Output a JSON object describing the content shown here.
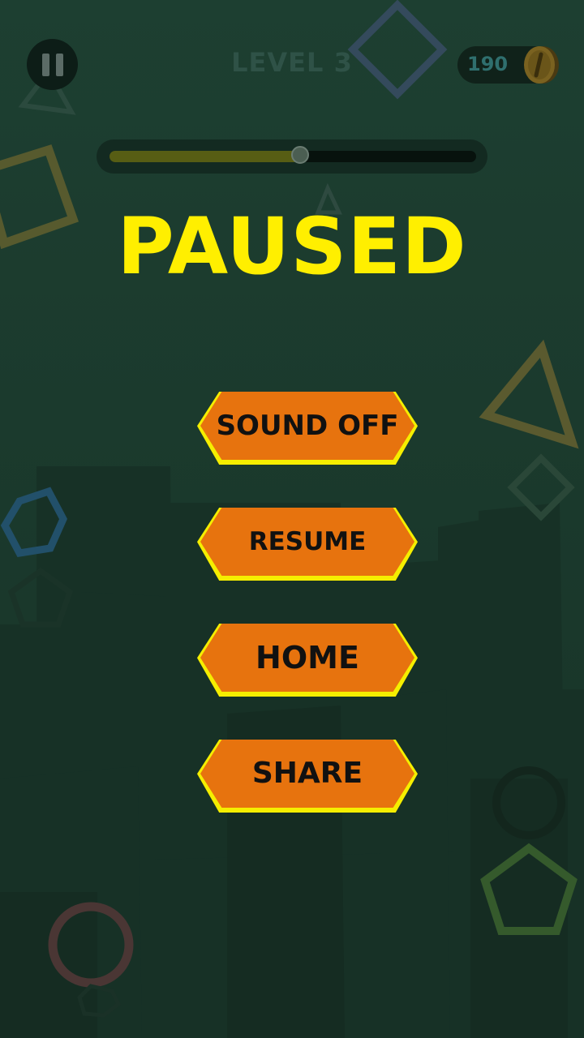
{
  "hud": {
    "pause_icon": "pause-icon",
    "level_label": "LEVEL 3",
    "coins": "190",
    "coin_icon": "coin-icon",
    "progress": 0.52
  },
  "title": "PAUSED",
  "menu": {
    "sound_label": "SOUND OFF",
    "resume_label": "RESUME",
    "home_label": "HOME",
    "share_label": "SHARE"
  },
  "colors": {
    "background": "#1b3a2d",
    "title": "#ffef00",
    "button_fill": "#e7730e",
    "button_edge": "#f5ee00",
    "button_text": "#111111"
  }
}
